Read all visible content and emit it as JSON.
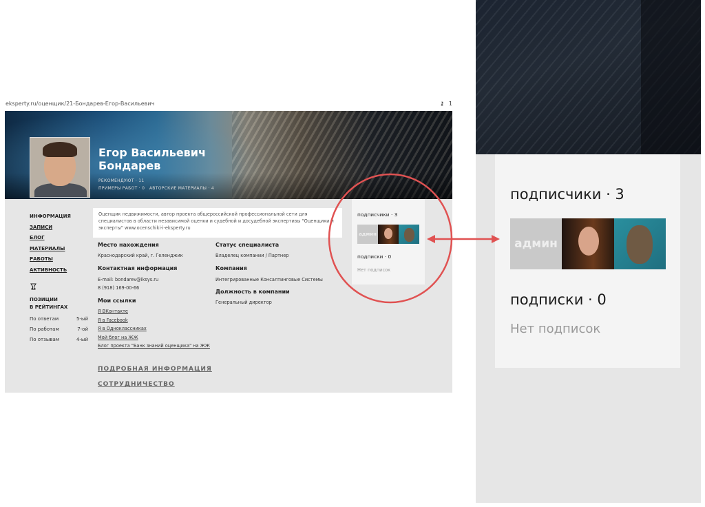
{
  "browser": {
    "url": "eksperty.ru/оценщик/21-Бондарев-Егор-Васильевич",
    "key_icon": "key-icon",
    "digit": "1"
  },
  "profile": {
    "name_line1": "Егор Васильевич",
    "name_line2": "Бондарев",
    "recommend": "РЕКОМЕНДУЮТ · 11",
    "examples": "ПРИМЕРЫ РАБОТ · 0",
    "materials": "АВТОРСКИЕ МАТЕРИАЛЫ · 4",
    "bio": "Оценщик недвижимости, автор проекта общероссийской профессиональной сети для специалистов в области независимой оценки и судебной и досудебной экспертизы \"Оценщики и эксперты\" www.ocenschiki-i-eksperty.ru"
  },
  "nav": [
    "ИНФОРМАЦИЯ",
    "ЗАПИСИ",
    "БЛОГ",
    "МАТЕРИАЛЫ",
    "РАБОТЫ",
    "АКТИВНОСТЬ"
  ],
  "ratings": {
    "title_line1": "ПОЗИЦИИ",
    "title_line2": "В РЕЙТИНГАХ",
    "rows": [
      {
        "label": "По ответам",
        "value": "5-ый"
      },
      {
        "label": "По работам",
        "value": "7-ой"
      },
      {
        "label": "По отзывам",
        "value": "4-ый"
      }
    ]
  },
  "info": {
    "location_h": "Место нахождения",
    "location": "Краснодарский край, г. Геленджик",
    "contacts_h": "Контактная информация",
    "email": "E-mail: bondarev@iksys.ru",
    "phone": "8 (918) 169-00-66",
    "links_h": "Мои ссылки",
    "links": [
      "Я ВКонтакте",
      "Я в Facebook",
      "Я в Одноклассниках",
      "Мой блог на ЖЖ",
      "Блог проекта \"Банк знаний оценщика\" на ЖЖ"
    ],
    "status_h": "Статус специалиста",
    "status": "Владелец компании / Партнер",
    "company_h": "Компания",
    "company": "Интегрированные Консалтинговые Системы",
    "position_h": "Должность в компании",
    "position": "Генеральный директор",
    "more_info": "ПОДРОБНАЯ ИНФОРМАЦИЯ",
    "cooperation": "СОТРУДНИЧЕСТВО"
  },
  "social": {
    "followers": "подписчики · 3",
    "following": "подписки · 0",
    "no_following": "Нет подписок",
    "admin_label": "админ"
  },
  "colors": {
    "highlight": "#e05252",
    "card": "#f4f4f4",
    "panel": "#e6e6e6"
  }
}
